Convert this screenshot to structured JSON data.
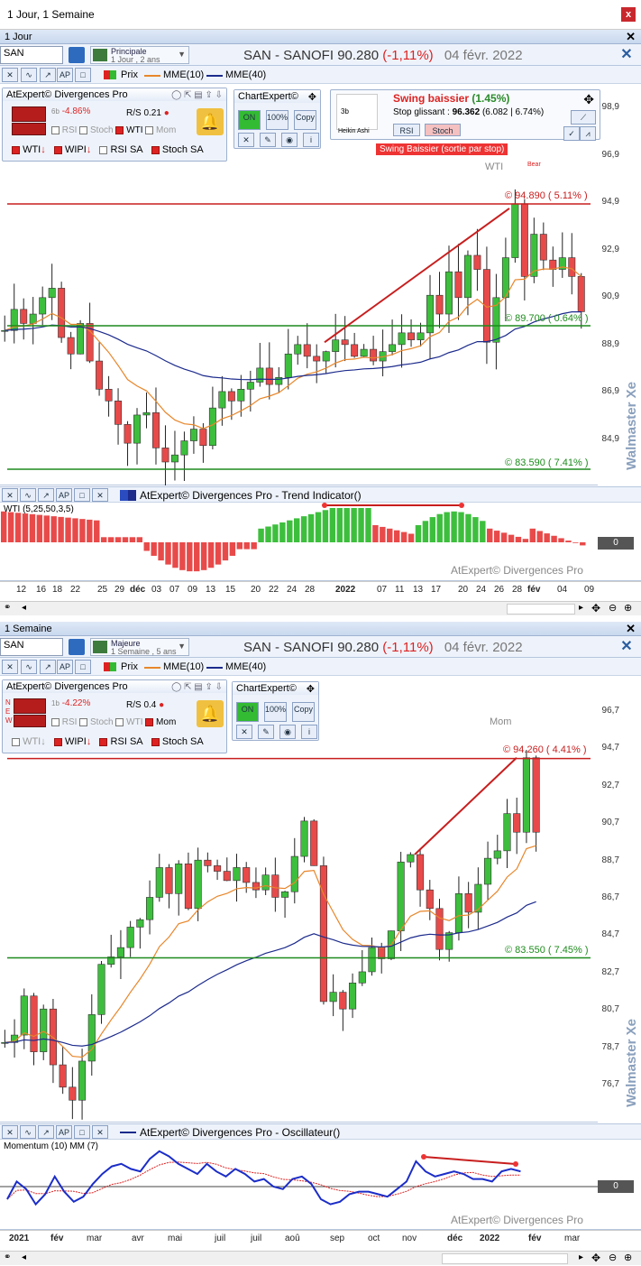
{
  "window": {
    "title": "1 Jour, 1 Semaine",
    "close": "x"
  },
  "panel1": {
    "header": "1 Jour",
    "symbol": "SAN",
    "scale": {
      "name": "Principale",
      "sub": "1 Jour , 2 ans"
    },
    "title": {
      "name": "SAN - SANOFI",
      "price": "90.280",
      "change": "(-1,11%)",
      "date": "04 févr. 2022"
    },
    "legend": {
      "prix": "Prix",
      "mme10": "MME(10)",
      "mme40": "MME(40)"
    },
    "atexpert": {
      "title": "AtExpert© Divergences Pro",
      "pct": "-4.86%",
      "badge": "6b",
      "rs": "0.21",
      "checks": [
        "RSI",
        "Stoch",
        "WTI",
        "Mom"
      ],
      "signals": [
        "WTI",
        "WIPI",
        "RSI SA",
        "Stoch SA"
      ]
    },
    "chartexpert": {
      "title": "ChartExpert©",
      "on": "ON",
      "pct": "100%",
      "copy": "Copy"
    },
    "swing": {
      "title": "Swing baissier",
      "pct": "(1.45%)",
      "stop_label": "Stop glissant :",
      "stop_value": "96.362",
      "stop_detail": "(6.082 | 6.74%)",
      "tabs": [
        "RSI",
        "Stoch"
      ],
      "heikin": "Heikin Ashi",
      "bars": "3b",
      "banner": "Swing Baissier (sortie par stop)"
    },
    "annotations": {
      "wti": "WTI",
      "bear": "Bear",
      "top": "© 94.890 ( 5.11% )",
      "mid": "© 89.700 ( 0.64% )",
      "low": "© 83.590 ( 7.41% )"
    },
    "yticks": [
      "98,9",
      "96,9",
      "94,9",
      "92,9",
      "90,9",
      "88,9",
      "86,9",
      "84,9"
    ],
    "watermark": "Walmaster Xe",
    "indicator": {
      "title": "AtExpert© Divergences Pro - Trend Indicator()",
      "name": "WTI (5,25,50,3,5)",
      "zero": "0",
      "credit": "AtExpert© Divergences Pro"
    },
    "xticks": [
      "12",
      "16",
      "18",
      "22",
      "25",
      "29",
      "déc",
      "03",
      "07",
      "09",
      "13",
      "15",
      "20",
      "22",
      "24",
      "28",
      "2022",
      "07",
      "11",
      "13",
      "17",
      "20",
      "24",
      "26",
      "28",
      "fév",
      "04",
      "09"
    ]
  },
  "panel2": {
    "header": "1 Semaine",
    "symbol": "SAN",
    "scale": {
      "name": "Majeure",
      "sub": "1 Semaine , 5 ans"
    },
    "title": {
      "name": "SAN - SANOFI",
      "price": "90.280",
      "change": "(-1,11%)",
      "date": "04 févr. 2022"
    },
    "legend": {
      "prix": "Prix",
      "mme10": "MME(10)",
      "mme40": "MME(40)"
    },
    "atexpert": {
      "title": "AtExpert© Divergences Pro",
      "pct": "-4.22%",
      "badge": "1b",
      "rs": "0.4",
      "checks": [
        "RSI",
        "Stoch",
        "WTI",
        "Mom"
      ],
      "signals": [
        "WTI",
        "WIPI",
        "RSI SA",
        "Stoch SA"
      ],
      "new": [
        "N",
        "E",
        "W"
      ]
    },
    "chartexpert": {
      "title": "ChartExpert©",
      "on": "ON",
      "pct": "100%",
      "copy": "Copy"
    },
    "annotations": {
      "mom": "Mom",
      "top": "© 94.260 ( 4.41% )",
      "low": "© 83.550 ( 7.45% )"
    },
    "yticks": [
      "96,7",
      "94,7",
      "92,7",
      "90,7",
      "88,7",
      "86,7",
      "84,7",
      "82,7",
      "80,7",
      "78,7",
      "76,7"
    ],
    "watermark": "Walmaster Xe",
    "indicator": {
      "title": "AtExpert© Divergences Pro - Oscillateur()",
      "name": "Momentum (10) MM (7)",
      "zero": "0",
      "credit": "AtExpert© Divergences Pro"
    },
    "xticks": [
      "2021",
      "fév",
      "mar",
      "avr",
      "mai",
      "juil",
      "juil",
      "aoû",
      "sep",
      "oct",
      "nov",
      "déc",
      "2022",
      "fév",
      "mar"
    ]
  },
  "colors": {
    "up": "#3dbf3d",
    "down": "#e84a4a",
    "mme10": "#e8862a",
    "mme40": "#1c2b8c",
    "resist": "#c81e1e",
    "support": "#1d8a1d"
  }
}
